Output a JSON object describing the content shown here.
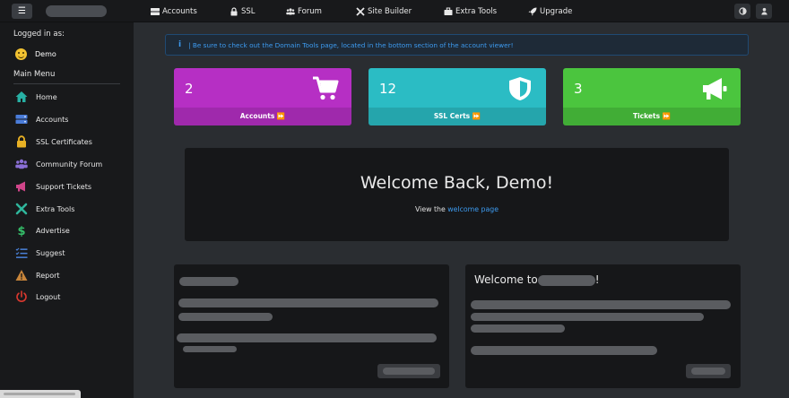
{
  "topbar": {
    "nav": [
      {
        "label": "Accounts",
        "icon": "server-icon"
      },
      {
        "label": "SSL",
        "icon": "lock-icon"
      },
      {
        "label": "Forum",
        "icon": "users-icon"
      },
      {
        "label": "Site Builder",
        "icon": "tools-icon"
      },
      {
        "label": "Extra Tools",
        "icon": "toolbox-icon"
      },
      {
        "label": "Upgrade",
        "icon": "rocket-icon"
      }
    ],
    "right_icons": [
      "contrast-icon",
      "user-icon"
    ]
  },
  "sidebar": {
    "logged_in_label": "Logged in as:",
    "username": "Demo",
    "main_menu_label": "Main Menu",
    "items": [
      {
        "label": "Home",
        "icon": "home-icon",
        "color": "#27b0a4"
      },
      {
        "label": "Accounts",
        "icon": "server-icon",
        "color": "#4a7cd9"
      },
      {
        "label": "SSL Certificates",
        "icon": "lock-icon",
        "color": "#e9b124"
      },
      {
        "label": "Community Forum",
        "icon": "users-icon",
        "color": "#8a6fd6"
      },
      {
        "label": "Support Tickets",
        "icon": "megaphone-icon",
        "color": "#d0458a"
      },
      {
        "label": "Extra Tools",
        "icon": "tools-icon",
        "color": "#2fb69c"
      },
      {
        "label": "Advertise",
        "icon": "dollar-icon",
        "color": "#35c06a"
      },
      {
        "label": "Suggest",
        "icon": "list-check-icon",
        "color": "#4a82d9"
      },
      {
        "label": "Report",
        "icon": "warning-icon",
        "color": "#c8853a"
      },
      {
        "label": "Logout",
        "icon": "power-icon",
        "color": "#d9382f"
      }
    ]
  },
  "alert": {
    "icon": "info-icon",
    "text": "| Be sure to check out the Domain Tools page, located in the bottom section of the account viewer!"
  },
  "stats": [
    {
      "count": "2",
      "label": "Accounts ⏩",
      "icon": "cart-icon",
      "color": "#b62fc4"
    },
    {
      "count": "12",
      "label": "SSL Certs ⏩",
      "icon": "shield-icon",
      "color": "#2bbcc4"
    },
    {
      "count": "3",
      "label": "Tickets ⏩",
      "icon": "megaphone-icon",
      "color": "#4bc53e"
    }
  ],
  "welcome": {
    "heading": "Welcome Back, Demo!",
    "prefix": "View the ",
    "link": "welcome page"
  },
  "panels": {
    "right_title_prefix": "Welcome to",
    "right_title_suffix": "!"
  }
}
